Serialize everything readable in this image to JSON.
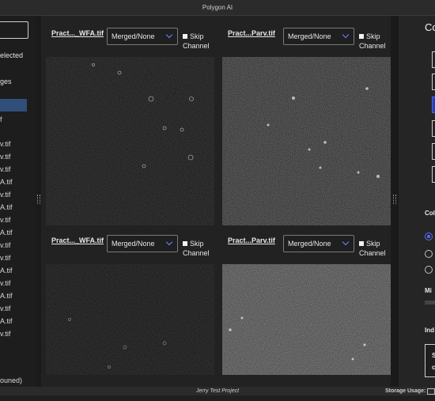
{
  "window": {
    "title": "Polygon AI"
  },
  "sidebar": {
    "label_1": "elected",
    "label_2": "ges",
    "files": [
      "f",
      "v.tif",
      "v.tif",
      "v.tif",
      "A.tif",
      "v.tif",
      "A.tif",
      "v.tif",
      "A.tif",
      "v.tif",
      "v.tif",
      "A.tif",
      "v.tif",
      "A.tif",
      "v.tif",
      "A.tif",
      "v.tif"
    ],
    "footer": "ouned)"
  },
  "panels": [
    {
      "name": "Pract..._WFA.tif",
      "mode": "Merged/None",
      "skip_label": "Skip Channel"
    },
    {
      "name": "Pract...Parv.tif",
      "mode": "Merged/None",
      "skip_label": "Skip Channel"
    },
    {
      "name": "Pract..._WFA.tif",
      "mode": "Merged/None",
      "skip_label": "Skip Channel"
    },
    {
      "name": "Pract...Parv.tif",
      "mode": "Merged/None",
      "skip_label": "Skip Channel"
    }
  ],
  "right_panel": {
    "title": "Co",
    "section_1": "Col",
    "section_2": "Mi",
    "section_3": "Ind",
    "card_line_1": "S",
    "card_line_2": "c"
  },
  "status": {
    "project": "Jerry Test Project",
    "storage_label": "Storage Usage:"
  },
  "colors": {
    "accent": "#3d66ff",
    "chevron": "#6f86ff"
  },
  "icons": [
    "chevron-down-icon",
    "checkbox-icon",
    "grip-icon",
    "radio-icon"
  ]
}
